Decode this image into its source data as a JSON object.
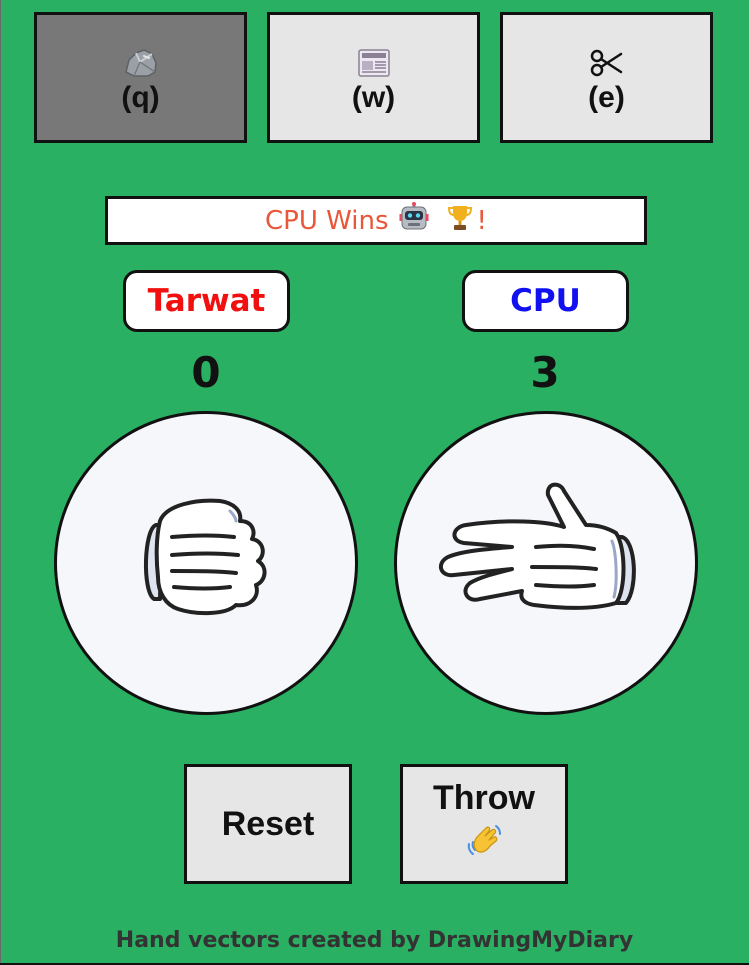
{
  "choices": [
    {
      "key_label": "(q)",
      "icon": "rock-icon",
      "selected": true
    },
    {
      "key_label": "(w)",
      "icon": "newspaper-icon",
      "selected": false
    },
    {
      "key_label": "(e)",
      "icon": "scissors-icon",
      "selected": false
    }
  ],
  "result": {
    "text": "CPU Wins",
    "exclaim": "!",
    "icons": [
      "robot-icon",
      "trophy-icon"
    ],
    "color": "#e8573a"
  },
  "players": {
    "player": {
      "name": "Tarwat",
      "score": "0",
      "color": "#f01010",
      "hand": "rock"
    },
    "cpu": {
      "name": "CPU",
      "score": "3",
      "color": "#1010f0",
      "hand": "paper"
    }
  },
  "actions": {
    "reset_label": "Reset",
    "throw_label": "Throw",
    "throw_icon": "waving-hand-icon"
  },
  "footer": {
    "credit": "Hand vectors created by DrawingMyDiary"
  },
  "colors": {
    "background": "#2ab062",
    "button_bg": "#e6e6e6",
    "selected_bg": "#787878"
  }
}
